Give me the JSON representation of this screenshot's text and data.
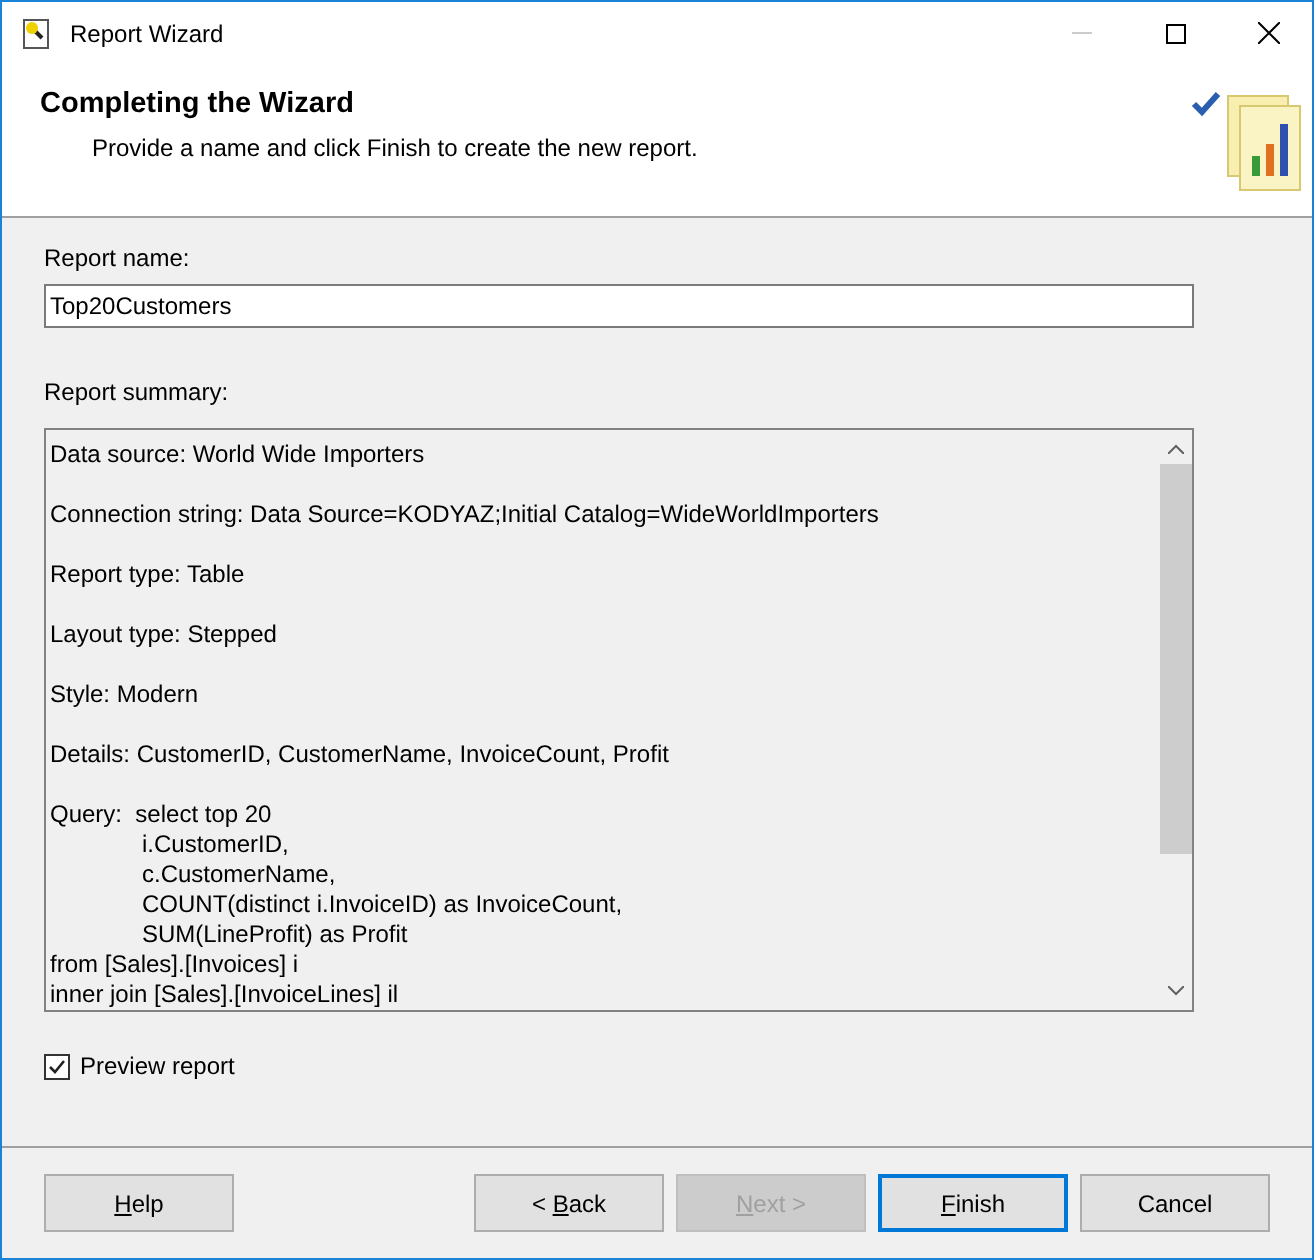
{
  "window": {
    "title": "Report Wizard"
  },
  "header": {
    "title": "Completing the Wizard",
    "subtitle": "Provide a name and click Finish to create the new report."
  },
  "report_name": {
    "label": "Report name:",
    "value": "Top20Customers"
  },
  "report_summary": {
    "label": "Report summary:",
    "paragraphs": [
      {
        "lines": [
          {
            "text": "Data source: World Wide Importers"
          }
        ]
      },
      {
        "lines": [
          {
            "text": "Connection string: Data Source=KODYAZ;Initial Catalog=WideWorldImporters"
          }
        ]
      },
      {
        "lines": [
          {
            "text": "Report type: Table"
          }
        ]
      },
      {
        "lines": [
          {
            "text": "Layout type: Stepped"
          }
        ]
      },
      {
        "lines": [
          {
            "text": "Style: Modern"
          }
        ]
      },
      {
        "lines": [
          {
            "text": "Details: CustomerID, CustomerName, InvoiceCount, Profit"
          }
        ]
      },
      {
        "lines": [
          {
            "text": "Query:  select top 20",
            "children": [
              {
                "text": "i.CustomerID,"
              },
              {
                "text": "c.CustomerName,"
              },
              {
                "text": "COUNT(distinct i.InvoiceID) as InvoiceCount,"
              },
              {
                "text": "SUM(LineProfit) as Profit"
              }
            ]
          },
          {
            "text": "from [Sales].[Invoices] i"
          },
          {
            "text": "inner join [Sales].[InvoiceLines] il"
          }
        ]
      }
    ]
  },
  "preview": {
    "label": "Preview report",
    "checked": true
  },
  "help_button": {
    "key": "H",
    "after": "elp",
    "disabled": false,
    "default": false
  },
  "buttons": [
    {
      "before": "< ",
      "key": "B",
      "after": "ack",
      "disabled": false,
      "default": false
    },
    {
      "key": "N",
      "after": "ext >",
      "disabled": true,
      "default": false
    },
    {
      "key": "F",
      "after": "inish",
      "disabled": false,
      "default": true
    },
    {
      "before": "Cancel",
      "disabled": false,
      "default": false
    }
  ]
}
